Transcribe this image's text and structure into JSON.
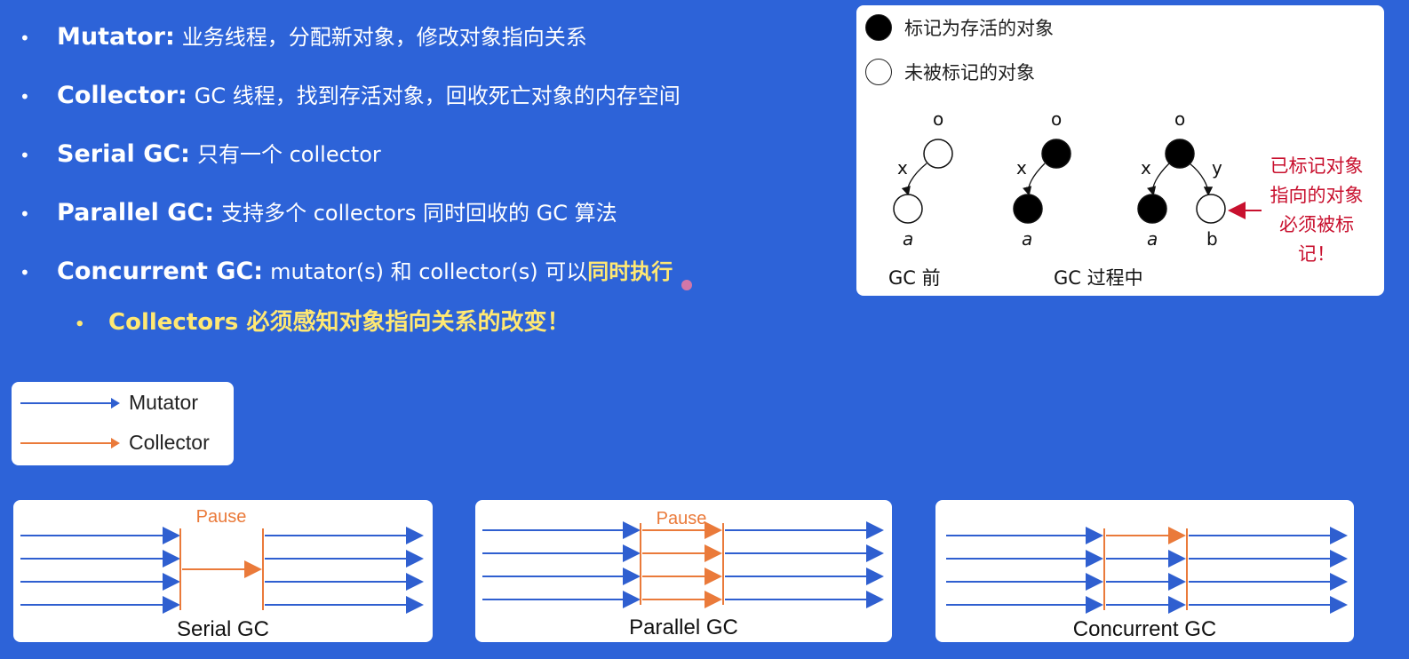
{
  "bullets": [
    {
      "term": "Mutator:",
      "text": "业务线程，分配新对象，修改对象指向关系"
    },
    {
      "term": "Collector:",
      "text": "GC 线程，找到存活对象，回收死亡对象的内存空间"
    },
    {
      "term": "Serial GC:",
      "text": "只有一个 collector"
    },
    {
      "term": "Parallel GC:",
      "text": "支持多个 collectors 同时回收的 GC 算法"
    },
    {
      "term": "Concurrent GC:",
      "text": "mutator(s) 和 collector(s) 可以",
      "highlight": "同时执行"
    }
  ],
  "sub_bullet": "Collectors 必须感知对象指向关系的改变！",
  "marking_legend": {
    "marked_label": "标记为存活的对象",
    "unmarked_label": "未被标记的对象",
    "before_caption": "GC 前",
    "during_caption": "GC 过程中",
    "note": "已标记对象\n指向的对象\n必须被标\n记！",
    "node_labels": {
      "root": "o",
      "edge_x": "x",
      "edge_y": "y",
      "leaf_a": "a",
      "leaf_b": "b"
    }
  },
  "arrow_legend": {
    "mutator": "Mutator",
    "collector": "Collector"
  },
  "gc_diagrams": {
    "serial": {
      "title": "Serial GC",
      "pause": "Pause"
    },
    "parallel": {
      "title": "Parallel GC",
      "pause": "Pause"
    },
    "concurrent": {
      "title": "Concurrent GC"
    }
  },
  "colors": {
    "background": "#2d63d8",
    "mutator": "#2f5fd0",
    "collector": "#ea7a3a",
    "highlight": "#ffe873",
    "note": "#c8102e"
  }
}
